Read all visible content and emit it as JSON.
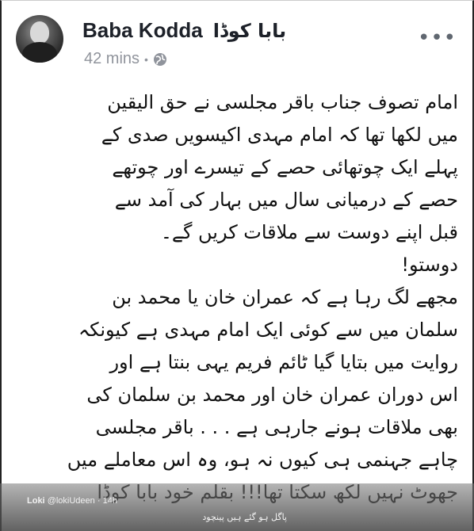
{
  "post": {
    "author_name": "Baba Kodda",
    "author_name_urdu": "بابا کوڈا",
    "time": "42 mins",
    "separator": "•",
    "privacy_icon": "globe-icon",
    "menu_label": "•••",
    "body_lines": [
      "امام تصوف جناب باقر مجلسی نے حق الیقین",
      "میں لکھا تھا کہ امام مہدی اکیسویں صدی کے",
      "پہلے ایک چوتھائی حصے کے تیسرے اور چوتھے",
      "حصے کے درمیانی سال میں بہار کی آمد سے",
      "قبل اپنے دوست سے ملاقات کریں گے۔",
      "دوستو!",
      "مجھے لگ رہا ہے کہ عمران خان یا محمد بن",
      "سلمان میں سے کوئی ایک امام مہدی ہے کیونکہ",
      "روایت میں بتایا گیا ٹائم فریم یہی بنتا ہے اور",
      "اس دوران عمران خان اور محمد بن سلمان کی",
      "بھی ملاقات ہونے جارہی ہے . . . باقر مجلسی",
      "چاہے جہنمی ہی کیوں نہ ہو، وہ اس معاملے میں",
      "جھوٹ نہیں لکھ سکتا تھا!!! بقلم خود بابا کوڈا"
    ]
  },
  "overlay": {
    "user_name": "Loki",
    "user_handle": "@lokiUdeen",
    "age": "14h",
    "caption": "پاگل ہو گئے ہیں پینچود"
  }
}
